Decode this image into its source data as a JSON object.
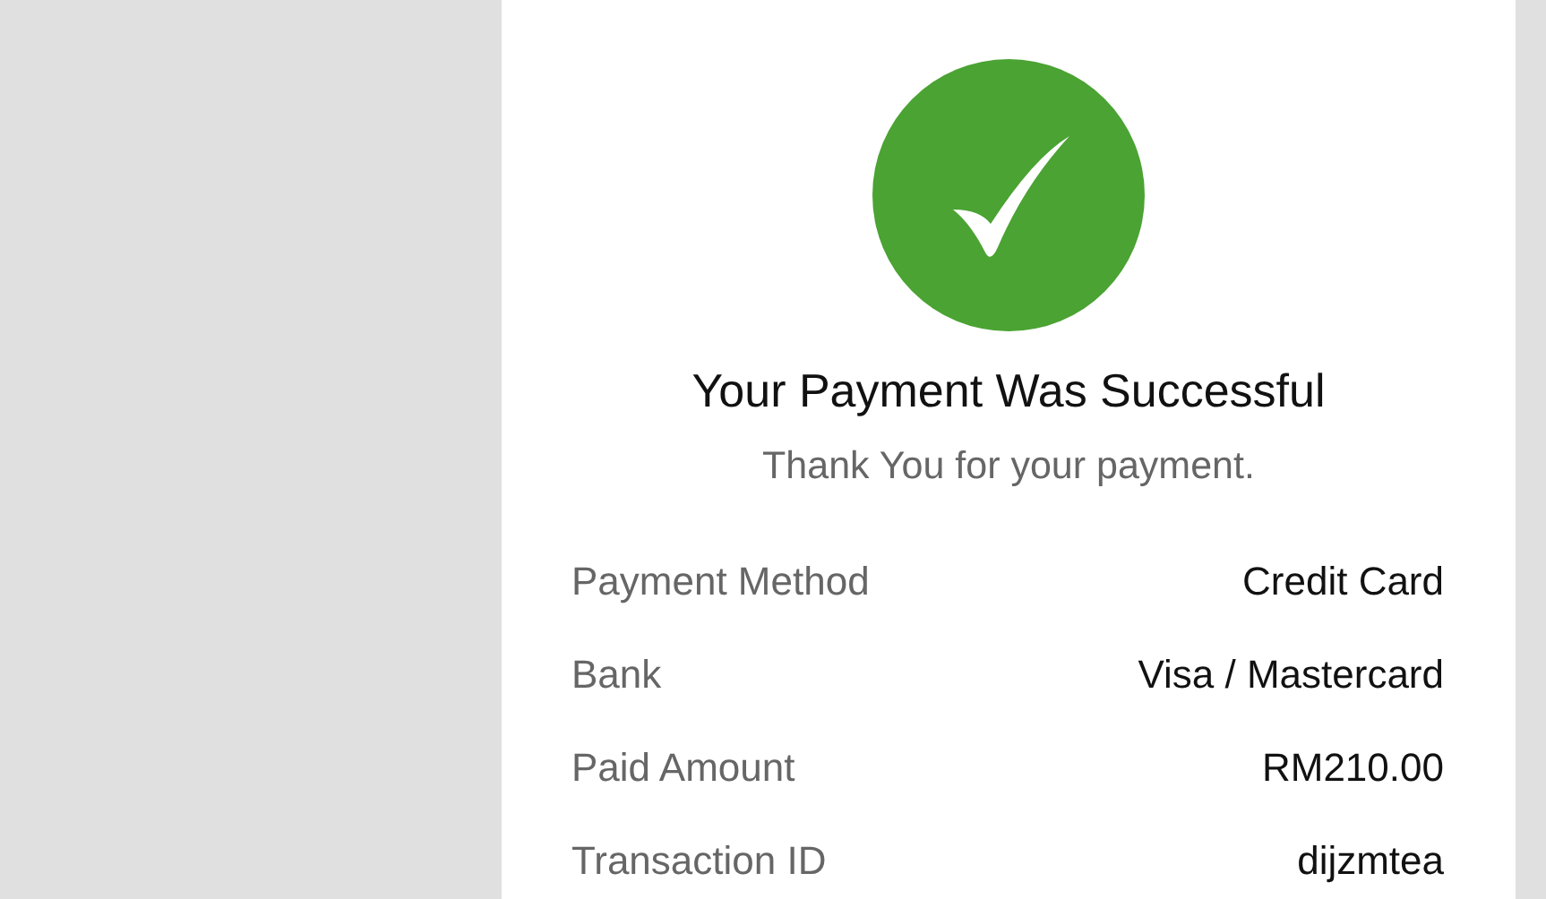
{
  "status": {
    "kind": "success",
    "title": "Your Payment Was Successful",
    "message": "Thank You for your payment."
  },
  "details": [
    {
      "label": "Payment Method",
      "value": "Credit Card"
    },
    {
      "label": "Bank",
      "value": "Visa / Mastercard"
    },
    {
      "label": "Paid Amount",
      "value": "RM210.00"
    },
    {
      "label": "Transaction ID",
      "value": "dijzmtea"
    }
  ]
}
